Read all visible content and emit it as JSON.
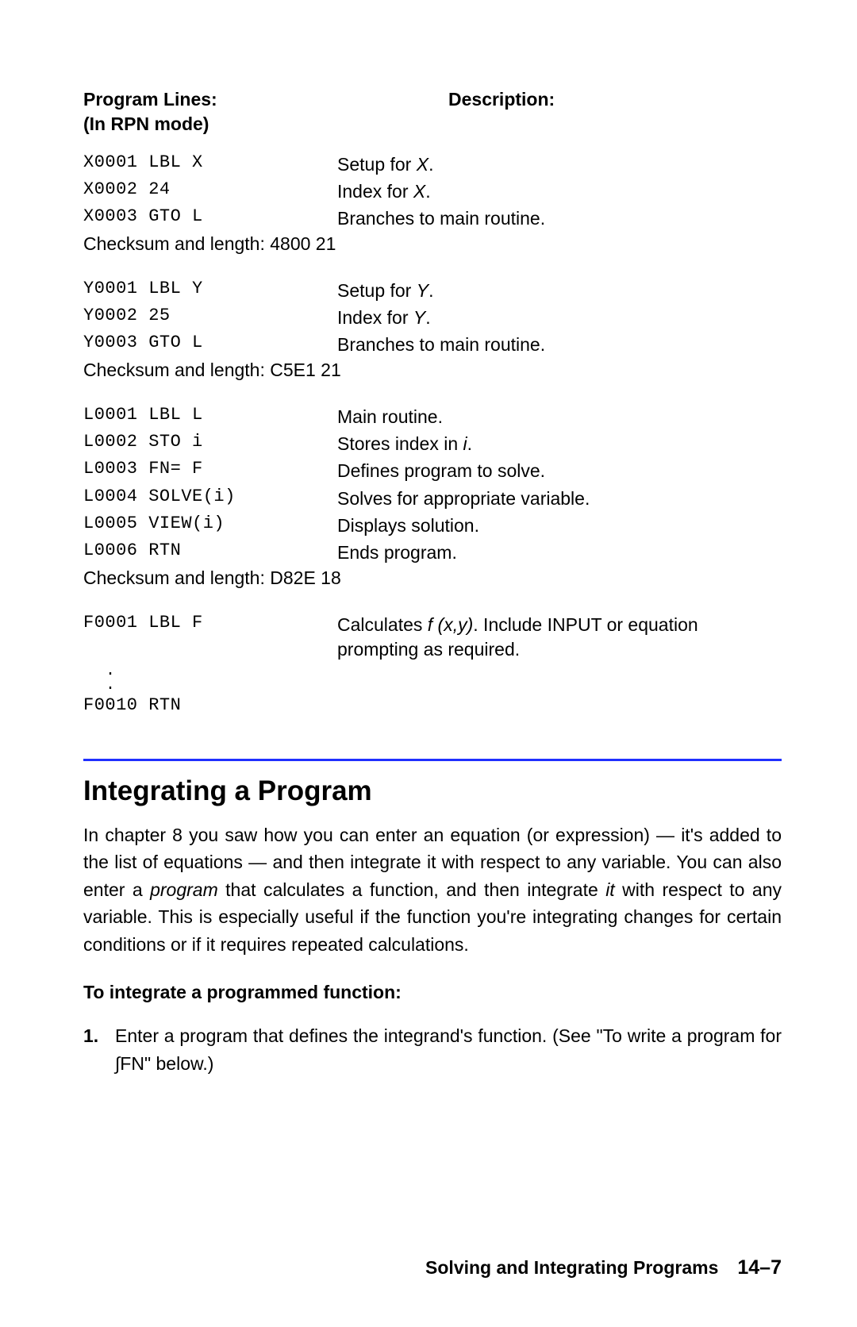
{
  "tableHeader": {
    "left_l1": "Program Lines:",
    "left_l2": "(In RPN mode)",
    "right": "Description:"
  },
  "blocks": [
    {
      "rows": [
        {
          "code": "X0001 LBL X",
          "desc_pre": "Setup for ",
          "desc_it": "X",
          "desc_post": "."
        },
        {
          "code": "X0002 24",
          "desc_pre": "Index for ",
          "desc_it": "X",
          "desc_post": "."
        },
        {
          "code": "X0003 GTO L",
          "desc_pre": "Branches to main routine.",
          "desc_it": "",
          "desc_post": ""
        }
      ],
      "checksum": "Checksum and length: 4800   21"
    },
    {
      "rows": [
        {
          "code": "Y0001 LBL Y",
          "desc_pre": "Setup for ",
          "desc_it": "Y",
          "desc_post": "."
        },
        {
          "code": "Y0002 25",
          "desc_pre": "Index for ",
          "desc_it": "Y",
          "desc_post": "."
        },
        {
          "code": "Y0003 GTO L",
          "desc_pre": "Branches to main routine.",
          "desc_it": "",
          "desc_post": ""
        }
      ],
      "checksum": "Checksum and length: C5E1   21"
    },
    {
      "rows": [
        {
          "code": "L0001 LBL L",
          "desc_pre": "Main routine.",
          "desc_it": "",
          "desc_post": ""
        },
        {
          "code": "L0002 STO i",
          "desc_pre": "Stores index in ",
          "desc_it": "i",
          "desc_post": "."
        },
        {
          "code": "L0003 FN= F",
          "desc_pre": "Defines program to solve.",
          "desc_it": "",
          "desc_post": ""
        },
        {
          "code": "L0004 SOLVE(i)",
          "desc_pre": "Solves for appropriate variable.",
          "desc_it": "",
          "desc_post": ""
        },
        {
          "code": "L0005 VIEW(i)",
          "desc_pre": "Displays solution.",
          "desc_it": "",
          "desc_post": ""
        },
        {
          "code": "L0006 RTN",
          "desc_pre": "Ends program.",
          "desc_it": "",
          "desc_post": ""
        }
      ],
      "checksum": "Checksum and length: D82E   18"
    }
  ],
  "fblock": {
    "first_code": "F0001 LBL F",
    "first_desc_pre": "Calculates ",
    "first_desc_it": "f (x,y)",
    "first_desc_post": ". Include INPUT or equation prompting as required.",
    "last_code": "F0010 RTN"
  },
  "section_title": "Integrating a Program",
  "para_pre": "In chapter 8 you saw how you can enter an equation (or expression) — it's added to the list of equations — and then integrate it with respect to any variable. You can also enter a ",
  "para_it1": "program",
  "para_mid": " that calculates a function, and then integrate ",
  "para_it2": "it",
  "para_post": " with respect to any variable. This is especially useful if the function you're integrating changes for certain conditions or if it requires repeated calculations.",
  "subhead": "To integrate a programmed function:",
  "step1_num": "1.",
  "step1_txt": "Enter a program that defines the integrand's function. (See \"To write a program for ∫FN\" below.)",
  "footer_title": "Solving and Integrating Programs",
  "footer_page": "14–7"
}
